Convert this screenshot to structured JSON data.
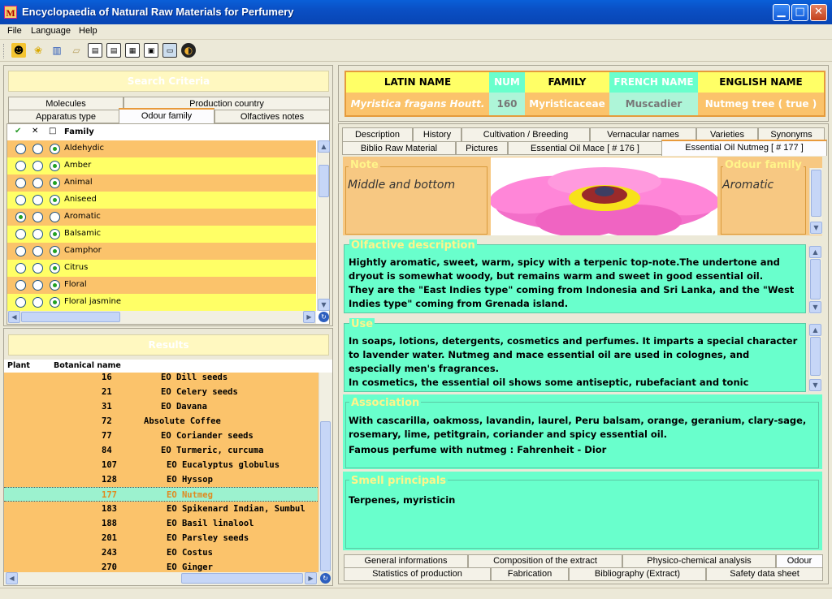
{
  "window": {
    "title": "Encyclopaedia of Natural Raw Materials for Perfumery",
    "app_icon": "M"
  },
  "menu": [
    "File",
    "Language",
    "Help"
  ],
  "toolbar_icons": [
    "person-icon",
    "flower-icon",
    "book-icon",
    "note-icon",
    "layout-icon-1",
    "layout-icon-2",
    "layout-icon-3",
    "layout-icon-4",
    "screen-icon",
    "globe-icon"
  ],
  "search": {
    "header": "Search Criteria",
    "tabs_row1": [
      "Molecules",
      "Production country"
    ],
    "tabs_row2": [
      "Apparatus type",
      "Odour family",
      "Olfactives notes"
    ],
    "active_tab": "Odour family",
    "col_check": "✔",
    "col_x": "✕",
    "col_box": "□",
    "col_family": "Family",
    "families": [
      {
        "name": "Aldehydic",
        "sel": 2
      },
      {
        "name": "Amber",
        "sel": 2
      },
      {
        "name": "Animal",
        "sel": 2
      },
      {
        "name": "Aniseed",
        "sel": 2
      },
      {
        "name": "Aromatic",
        "sel": 0
      },
      {
        "name": "Balsamic",
        "sel": 2
      },
      {
        "name": "Camphor",
        "sel": 2
      },
      {
        "name": "Citrus",
        "sel": 2
      },
      {
        "name": "Floral",
        "sel": 2
      },
      {
        "name": "Floral jasmine",
        "sel": 2
      }
    ]
  },
  "results": {
    "header": "Results",
    "col_plant": "Plant",
    "col_botanical": "Botanical name",
    "rows": [
      {
        "num": "16",
        "name": "EO Dill seeds",
        "indent": 2,
        "sel": false
      },
      {
        "num": "21",
        "name": "EO Celery seeds",
        "indent": 2,
        "sel": false
      },
      {
        "num": "31",
        "name": "EO Davana",
        "indent": 2,
        "sel": false
      },
      {
        "num": "72",
        "name": "Absolute Coffee",
        "indent": 0,
        "sel": false
      },
      {
        "num": "77",
        "name": "EO Coriander seeds",
        "indent": 2,
        "sel": false
      },
      {
        "num": "84",
        "name": "EO Turmeric, curcuma",
        "indent": 2,
        "sel": false
      },
      {
        "num": "107",
        "name": "EO Eucalyptus globulus",
        "indent": 2,
        "sel": false
      },
      {
        "num": "128",
        "name": "EO Hyssop",
        "indent": 2,
        "sel": false
      },
      {
        "num": "177",
        "name": "EO Nutmeg",
        "indent": 2,
        "sel": true
      },
      {
        "num": "183",
        "name": "EO Spikenard Indian, Sumbul",
        "indent": 2,
        "sel": false
      },
      {
        "num": "188",
        "name": "EO Basil linalool",
        "indent": 2,
        "sel": false
      },
      {
        "num": "201",
        "name": "EO Parsley seeds",
        "indent": 2,
        "sel": false
      },
      {
        "num": "243",
        "name": "EO Costus",
        "indent": 2,
        "sel": false
      },
      {
        "num": "270",
        "name": "EO Ginger",
        "indent": 2,
        "sel": false
      }
    ]
  },
  "info": {
    "latin_label": "LATIN NAME",
    "num_label": "NUM",
    "family_label": "FAMILY",
    "french_label": "FRENCH NAME",
    "english_label": "ENGLISH NAME",
    "latin": "Myristica fragans Houtt.",
    "num": "160",
    "family": "Myristicaceae",
    "french": "Muscadier",
    "english": "Nutmeg tree ( true )"
  },
  "detail_tabs_row1": [
    "Description",
    "History",
    "Cultivation / Breeding",
    "Vernacular names",
    "Varieties",
    "Synonyms"
  ],
  "detail_tabs_row2": [
    "Biblio Raw Material",
    "Pictures",
    "Essential Oil Mace [ # 176 ]",
    "Essential Oil Nutmeg [ # 177 ]"
  ],
  "active_detail_tab": "Essential Oil Nutmeg [ # 177 ]",
  "note": {
    "legend": "Note",
    "text": "Middle and bottom"
  },
  "odour_family": {
    "legend": "Odour family",
    "text": "Aromatic"
  },
  "olfactive": {
    "legend": "Olfactive description",
    "text": "Hightly aromatic, sweet, warm, spicy with a terpenic top-note.The undertone and dryout is somewhat woody, but remains warm and sweet in good essential oil.\nThey are the \"East Indies type\" coming from Indonesia and Sri Lanka, and the \"West Indies type\" coming from Grenada island."
  },
  "use": {
    "legend": "Use",
    "text": "In soaps, lotions, detergents, cosmetics and perfumes. It imparts a special character to lavender water. Nutmeg and mace essential oil are used in colognes, and especially men's fragrances.\nIn cosmetics, the essential oil shows some antiseptic, rubefaciant and tonic"
  },
  "association": {
    "legend": "Association",
    "text": "With cascarilla, oakmoss, lavandin, laurel, Peru balsam, orange, geranium, clary-sage, rosemary, lime, petitgrain, coriander and spicy essential oil.",
    "text2": "Famous perfume with nutmeg : Fahrenheit - Dior"
  },
  "smell": {
    "legend": "Smell principals",
    "text": "Terpenes, myristicin"
  },
  "bottom_tabs_row1": [
    "General informations",
    "Composition of the extract",
    "Physico-chemical analysis",
    "Odour"
  ],
  "bottom_tabs_row2": [
    "Statistics of production",
    "Fabrication",
    "Bibliography (Extract)",
    "Safety data sheet"
  ],
  "active_bottom_tab": "Odour",
  "colors": {
    "orange": "#fbc36b",
    "yellow": "#ffff66",
    "mint": "#69ffcc",
    "peach": "#f7c882"
  }
}
